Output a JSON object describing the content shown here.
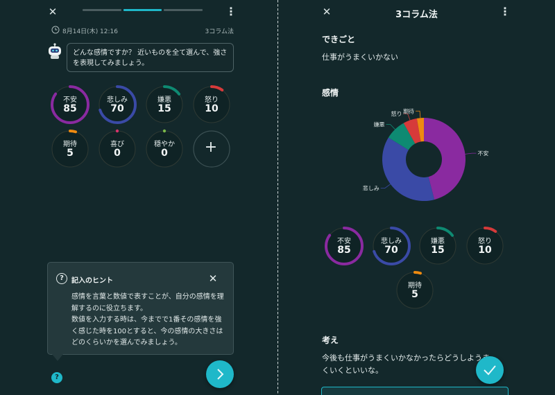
{
  "left": {
    "progress": [
      false,
      true,
      false
    ],
    "date": "8月14日(木) 12:16",
    "method": "3コラム法",
    "prompt": "どんな感情ですか？ 近いものを全て選んで、強さを表現してみましょう。",
    "emotions": [
      {
        "name": "不安",
        "value": 85,
        "color": "#8a2aa0"
      },
      {
        "name": "悲しみ",
        "value": 70,
        "color": "#3a4aa6"
      },
      {
        "name": "嫌悪",
        "value": 15,
        "color": "#0e8a72"
      },
      {
        "name": "怒り",
        "value": 10,
        "color": "#d63a3a"
      },
      {
        "name": "期待",
        "value": 5,
        "color": "#ee8a10"
      },
      {
        "name": "喜び",
        "value": 0,
        "color": "#d6336b"
      },
      {
        "name": "穏やか",
        "value": 0,
        "color": "#7ab84a"
      }
    ],
    "add_symbol": "+",
    "hint": {
      "title": "記入のヒント",
      "body": [
        "感情を言葉と数値で表すことが、自分の感情を理解するのに役立ちます。",
        "数値を入力する時は、今までで1番その感情を強く感じた時を100とすると、今の感情の大きさはどのくらいかを選んでみましょう。"
      ]
    },
    "help_symbol": "?"
  },
  "right": {
    "title": "3コラム法",
    "event_heading": "できごと",
    "event_text": "仕事がうまくいかない",
    "emotion_heading": "感情",
    "thought_heading": "考え",
    "thought_text": "今後も仕事がうまくいかなかったらどうしようまくいくといいな。"
  },
  "chart_data": {
    "type": "pie",
    "hole": true,
    "categories": [
      "不安",
      "悲しみ",
      "嫌悪",
      "怒り",
      "期待"
    ],
    "values": [
      85,
      70,
      15,
      10,
      5
    ],
    "colors": [
      "#8a2aa0",
      "#3a4aa6",
      "#0e8a72",
      "#d63a3a",
      "#ee8a10"
    ]
  },
  "icons": {
    "close": "close-icon",
    "menu": "kebab-menu-icon",
    "clock": "clock-icon",
    "next": "chevron-right-icon",
    "check": "check-icon"
  }
}
